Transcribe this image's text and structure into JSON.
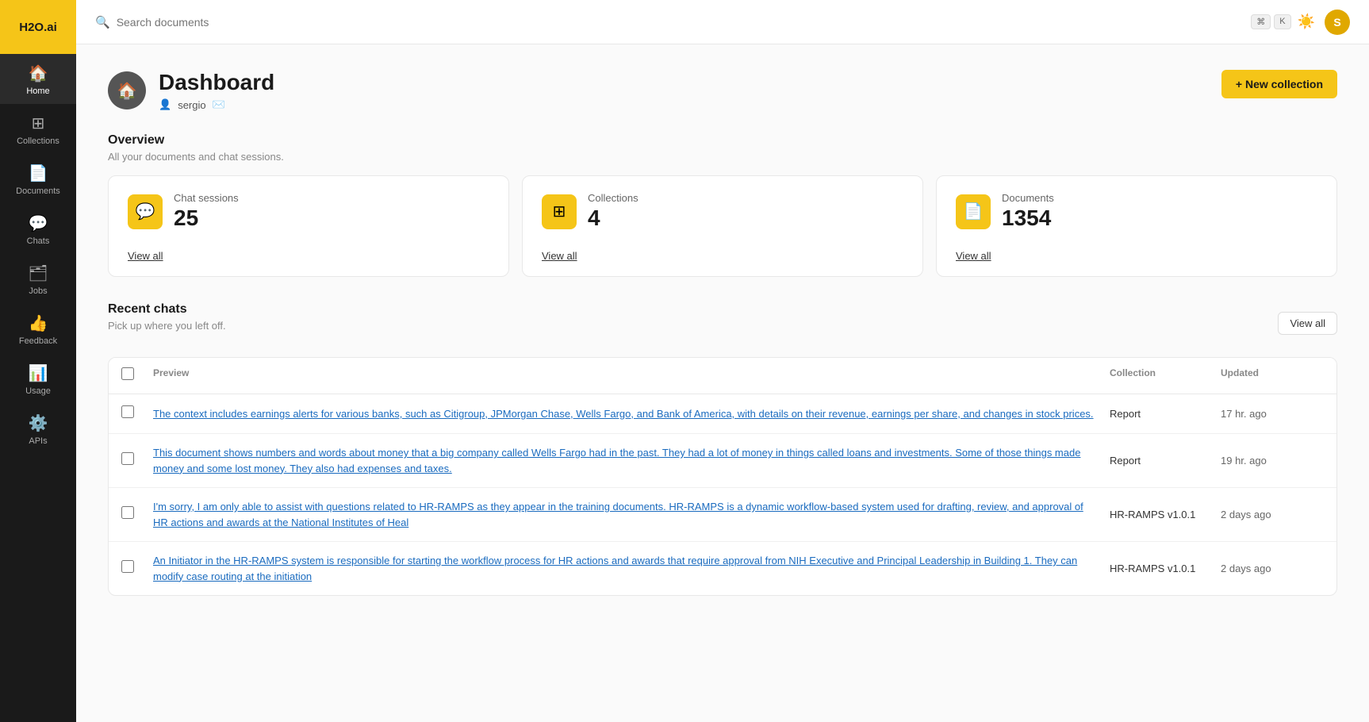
{
  "app": {
    "logo": "H2O.ai"
  },
  "topbar": {
    "search_placeholder": "Search documents",
    "kbd1": "⌘",
    "kbd2": "K"
  },
  "sidebar": {
    "items": [
      {
        "id": "home",
        "label": "Home",
        "icon": "🏠",
        "active": true
      },
      {
        "id": "collections",
        "label": "Collections",
        "icon": "⊞",
        "active": false
      },
      {
        "id": "documents",
        "label": "Documents",
        "icon": "📄",
        "active": false
      },
      {
        "id": "chats",
        "label": "Chats",
        "icon": "💬",
        "active": false
      },
      {
        "id": "jobs",
        "label": "Jobs",
        "icon": "🗂",
        "active": false
      },
      {
        "id": "feedback",
        "label": "Feedback",
        "icon": "👍",
        "active": false
      },
      {
        "id": "usage",
        "label": "Usage",
        "icon": "📊",
        "active": false
      },
      {
        "id": "apis",
        "label": "APIs",
        "icon": "⚙️",
        "active": false
      }
    ]
  },
  "dashboard": {
    "title": "Dashboard",
    "icon": "🏠",
    "user": "sergio",
    "new_collection_label": "+ New collection"
  },
  "overview": {
    "title": "Overview",
    "subtitle": "All your documents and chat sessions.",
    "stats": [
      {
        "label": "Chat sessions",
        "value": "25",
        "icon": "💬",
        "view_all": "View all"
      },
      {
        "label": "Collections",
        "value": "4",
        "icon": "⊞",
        "view_all": "View all"
      },
      {
        "label": "Documents",
        "value": "1354",
        "icon": "📄",
        "view_all": "View all"
      }
    ]
  },
  "recent_chats": {
    "title": "Recent chats",
    "subtitle": "Pick up where you left off.",
    "view_all_label": "View all",
    "columns": {
      "preview": "Preview",
      "collection": "Collection",
      "updated": "Updated"
    },
    "rows": [
      {
        "preview": "The context includes earnings alerts for various banks, such as Citigroup, JPMorgan Chase, Wells Fargo, and Bank of America, with details on their revenue, earnings per share, and changes in stock prices.",
        "collection": "Report",
        "updated": "17 hr. ago"
      },
      {
        "preview": "This document shows numbers and words about money that a big company called Wells Fargo had in the past. They had a lot of money in things called loans and investments. Some of those things made money and some lost money. They also had expenses and taxes.",
        "collection": "Report",
        "updated": "19 hr. ago"
      },
      {
        "preview": "I'm sorry, I am only able to assist with questions related to HR-RAMPS as they appear in the training documents. HR-RAMPS is a dynamic workflow-based system used for drafting, review, and approval of HR actions and awards at the National Institutes of Heal",
        "collection": "HR-RAMPS v1.0.1",
        "updated": "2 days ago"
      },
      {
        "preview": "An Initiator in the HR-RAMPS system is responsible for starting the workflow process for HR actions and awards that require approval from NIH Executive and Principal Leadership in Building 1. They can modify case routing at the initiation",
        "collection": "HR-RAMPS v1.0.1",
        "updated": "2 days ago"
      }
    ]
  }
}
